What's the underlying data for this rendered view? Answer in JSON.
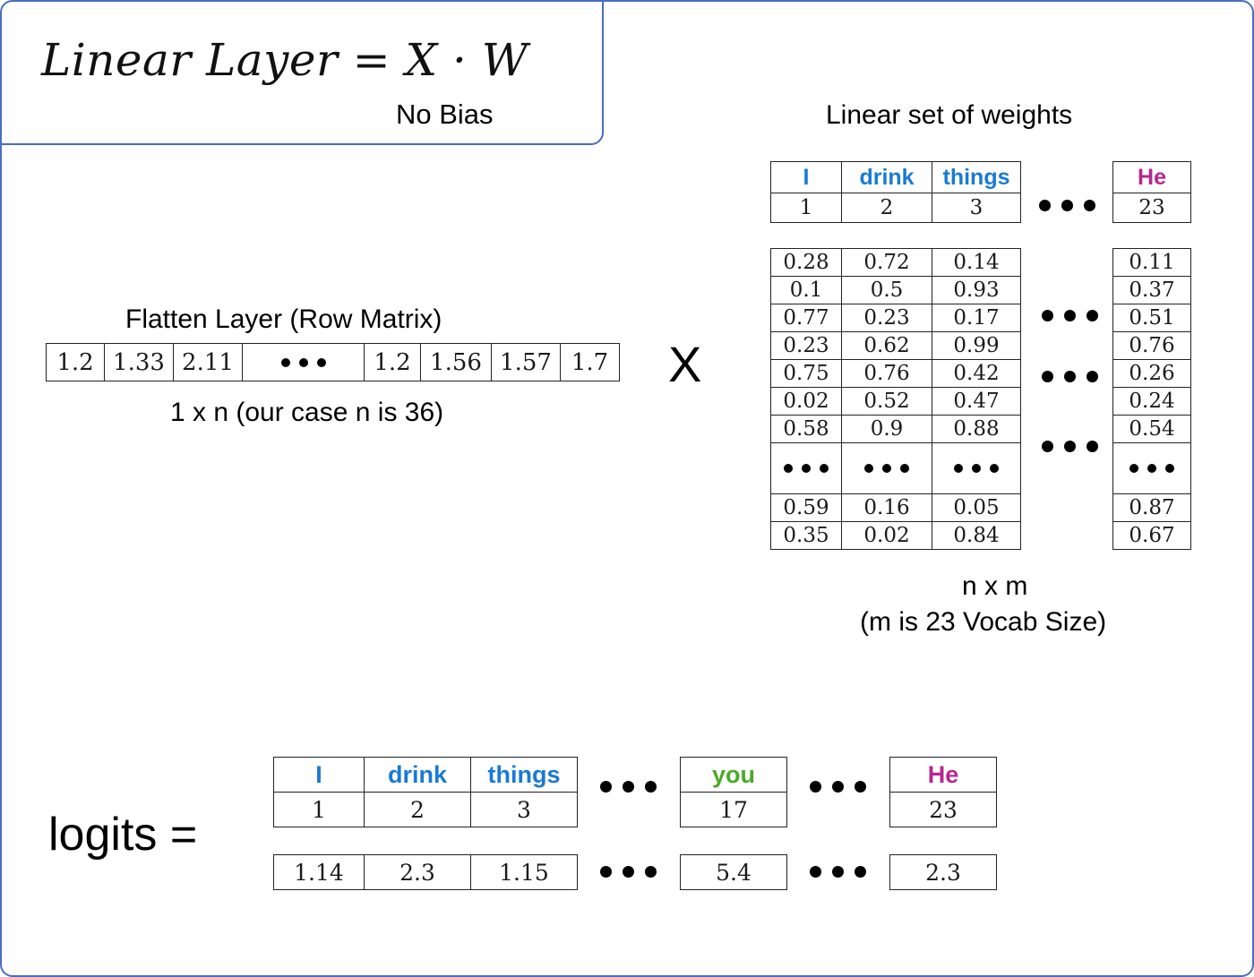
{
  "title_box": {
    "formula": "Linear  Layer = X · W",
    "note": "No Bias"
  },
  "flatten": {
    "caption_top": "Flatten Layer (Row Matrix)",
    "caption_bottom": "1 x n (our case n is 36)",
    "values": [
      "1.2",
      "1.33",
      "2.11",
      "•••",
      "1.2",
      "1.56",
      "1.57",
      "1.7"
    ]
  },
  "multiply_symbol": "X",
  "weights": {
    "caption_top": "Linear set of weights",
    "caption_bottom_line1": "n x m",
    "caption_bottom_line2": "(m is 23 Vocab Size)",
    "header_words": [
      "I",
      "drink",
      "things"
    ],
    "header_word_colors": [
      "#1a7ad4",
      "#1a7ad4",
      "#1a7ad4"
    ],
    "header_indices": [
      "1",
      "2",
      "3"
    ],
    "last_word": "He",
    "last_word_color": "#b5268f",
    "last_index": "23",
    "matrix": [
      [
        "0.28",
        "0.72",
        "0.14"
      ],
      [
        "0.1",
        "0.5",
        "0.93"
      ],
      [
        "0.77",
        "0.23",
        "0.17"
      ],
      [
        "0.23",
        "0.62",
        "0.99"
      ],
      [
        "0.75",
        "0.76",
        "0.42"
      ],
      [
        "0.02",
        "0.52",
        "0.47"
      ],
      [
        "0.58",
        "0.9",
        "0.88"
      ],
      [
        "…",
        "…",
        "…"
      ],
      [
        "0.59",
        "0.16",
        "0.05"
      ],
      [
        "0.35",
        "0.02",
        "0.84"
      ]
    ],
    "last_column": [
      "0.11",
      "0.37",
      "0.51",
      "0.76",
      "0.26",
      "0.24",
      "0.54",
      "…",
      "0.87",
      "0.67"
    ]
  },
  "logits": {
    "label": "logits =",
    "words": [
      "I",
      "drink",
      "things"
    ],
    "word_colors": [
      "#1a7ad4",
      "#1a7ad4",
      "#1a7ad4"
    ],
    "indices": [
      "1",
      "2",
      "3"
    ],
    "values": [
      "1.14",
      "2.3",
      "1.15"
    ],
    "mid_word": "you",
    "mid_word_color": "#4aaa27",
    "mid_index": "17",
    "mid_value": "5.4",
    "last_word": "He",
    "last_word_color": "#b5268f",
    "last_index": "23",
    "last_value": "2.3"
  },
  "colors": {
    "page_border": "#4a6cc4",
    "blue": "#1a7ad4",
    "magenta": "#b5268f",
    "green": "#4aaa27",
    "table_border": "#222222"
  }
}
